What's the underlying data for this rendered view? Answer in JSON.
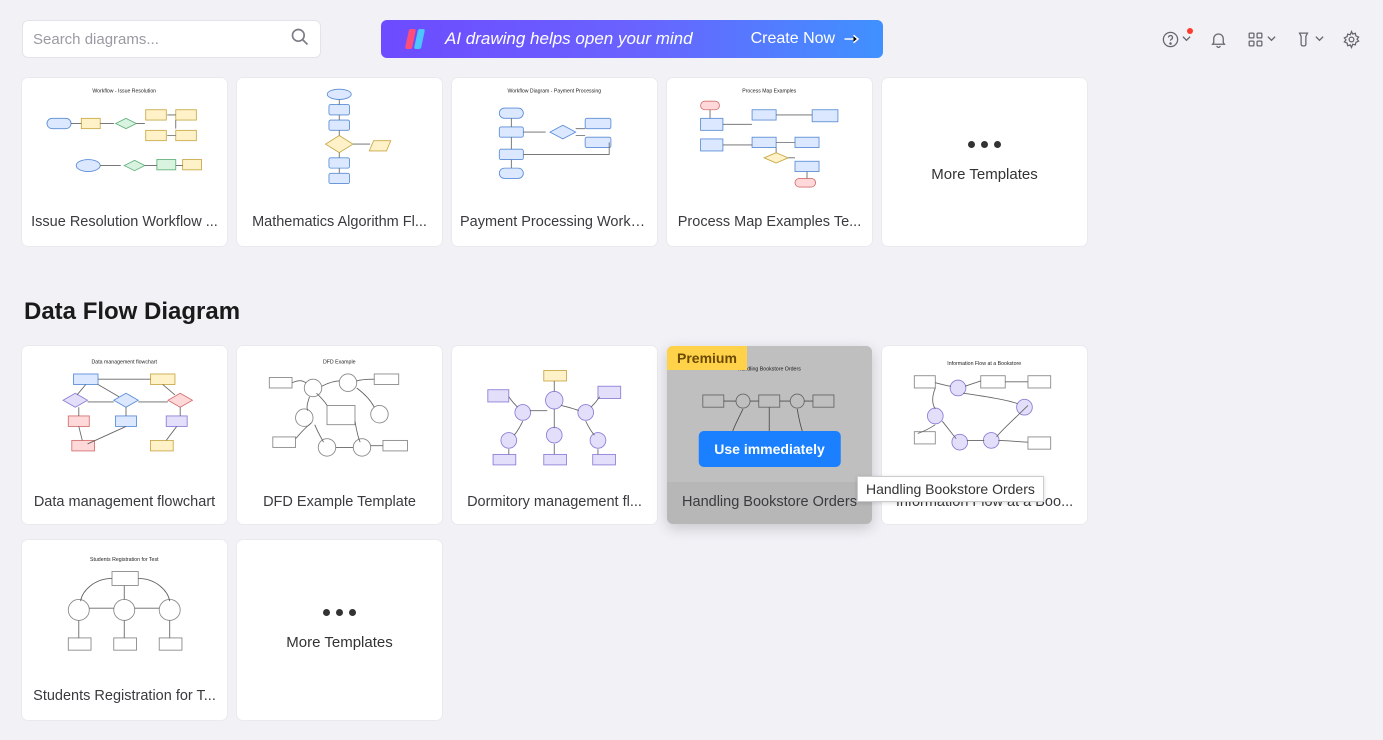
{
  "search": {
    "placeholder": "Search diagrams..."
  },
  "banner": {
    "text": "AI drawing helps open your mind",
    "cta": "Create Now"
  },
  "more_templates_label": "More Templates",
  "section1": {
    "cards": [
      {
        "title": "Issue Resolution Workflow ..."
      },
      {
        "title": "Mathematics Algorithm Fl..."
      },
      {
        "title": "Payment Processing Workfl..."
      },
      {
        "title": "Process Map Examples Te..."
      }
    ]
  },
  "section2": {
    "title": "Data Flow Diagram",
    "cards": [
      {
        "title": "Data management flowchart"
      },
      {
        "title": "DFD Example Template"
      },
      {
        "title": "Dormitory management fl..."
      },
      {
        "title": "Handling Bookstore Orders",
        "premium": true,
        "hover": true
      },
      {
        "title": "Information Flow at a Boo..."
      }
    ],
    "cards_row3": [
      {
        "title": "Students Registration for T..."
      }
    ],
    "premium_label": "Premium",
    "use_immediately": "Use immediately",
    "tooltip": "Handling Bookstore Orders"
  }
}
